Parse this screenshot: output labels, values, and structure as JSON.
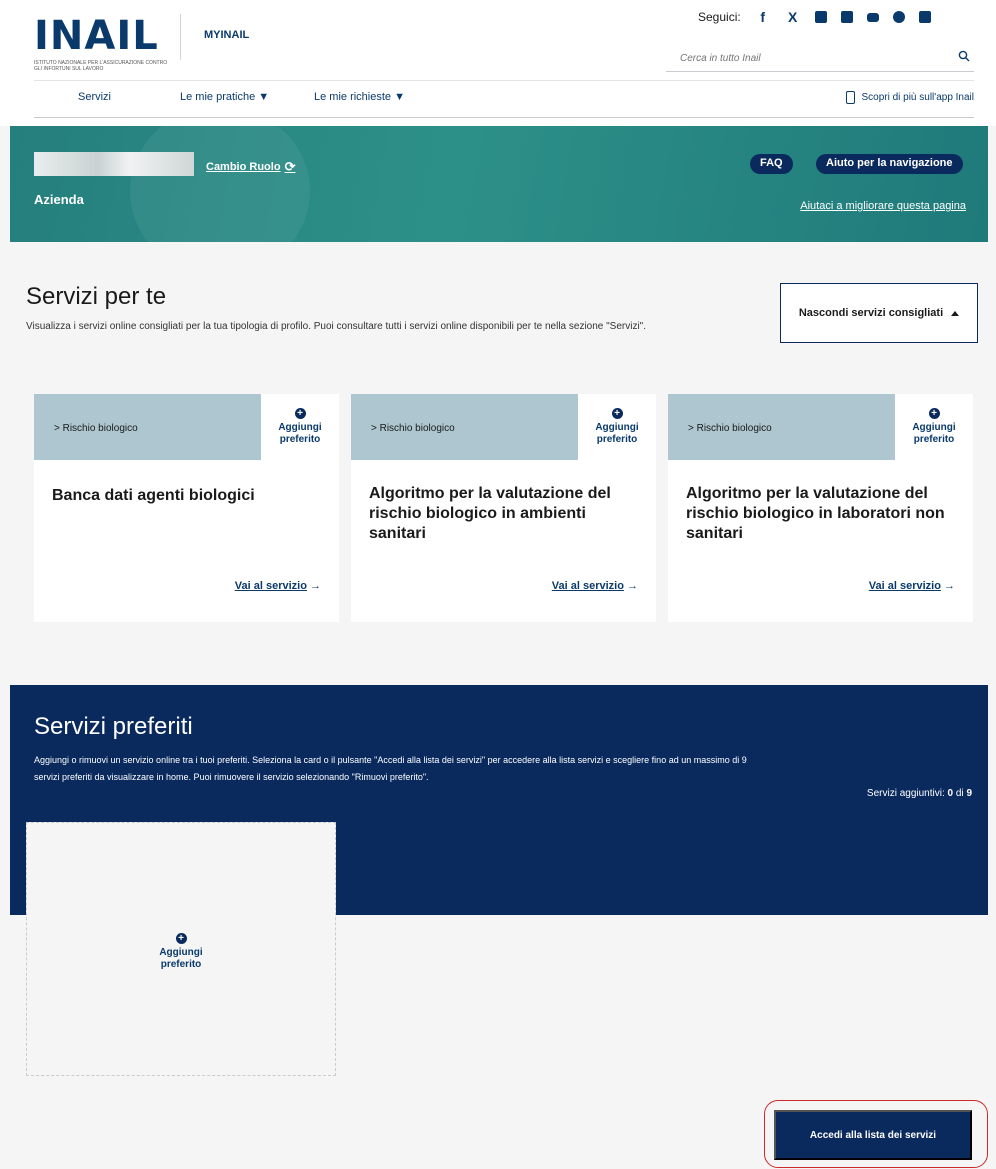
{
  "header": {
    "logo_text": "INAIL",
    "logo_subtitle": "ISTITUTO NAZIONALE PER L'ASSICURAZIONE CONTRO GLI INFORTUNI SUL LAVORO",
    "app_name": "MYINAIL",
    "follow_label": "Seguici:",
    "social": [
      "f",
      "X"
    ],
    "search_placeholder": "Cerca in tutto Inail"
  },
  "nav": {
    "items": [
      {
        "label": "Servizi"
      },
      {
        "label": "Le mie pratiche ▼"
      },
      {
        "label": "Le mie richieste ▼"
      }
    ],
    "app_link": "Scopri di più sull'app Inail"
  },
  "banner": {
    "role_link": "Cambio Ruolo",
    "role": "Azienda",
    "faq": "FAQ",
    "help": "Aiuto per la navigazione",
    "improve": "Aiutaci a migliorare questa pagina"
  },
  "suggested": {
    "title": "Servizi per te",
    "description": "Visualizza i servizi online consigliati per la tua tipologia di profilo. Puoi consultare tutti i servizi online disponibili per te nella sezione \"Servizi\".",
    "toggle_label": "Nascondi servizi consigliati",
    "cards": [
      {
        "tag": "> Rischio biologico",
        "fav": "Aggiungi preferito",
        "title": "Banca dati agenti biologici",
        "link": "Vai al servizio"
      },
      {
        "tag": "> Rischio biologico",
        "fav": "Aggiungi preferito",
        "title": "Algoritmo per la valutazione del rischio biologico in ambienti sanitari",
        "link": "Vai al servizio"
      },
      {
        "tag": "> Rischio biologico",
        "fav": "Aggiungi preferito",
        "title": "Algoritmo per la valutazione del rischio biologico in laboratori non sanitari",
        "link": "Vai al servizio"
      }
    ]
  },
  "favorites": {
    "title": "Servizi preferiti",
    "description": "Aggiungi o rimuovi un servizio online tra i tuoi preferiti. Seleziona la card o il pulsante \"Accedi alla lista dei servizi\" per accedere alla lista servizi e scegliere fino ad un massimo di 9 servizi preferiti da visualizzare in home. Puoi rimuovere il servizio selezionando \"Rimuovi preferito\".",
    "count_label": "Servizi aggiuntivi:",
    "count_value": "0",
    "count_of": "di",
    "count_max": "9",
    "empty_card_label": "Aggiungi preferito",
    "access_button": "Accedi alla lista dei servizi"
  },
  "colors": {
    "navy": "#0a2a5e",
    "teal": "#2d9088",
    "tag_bg": "#aec6d0",
    "highlight": "#cc2b2b"
  }
}
